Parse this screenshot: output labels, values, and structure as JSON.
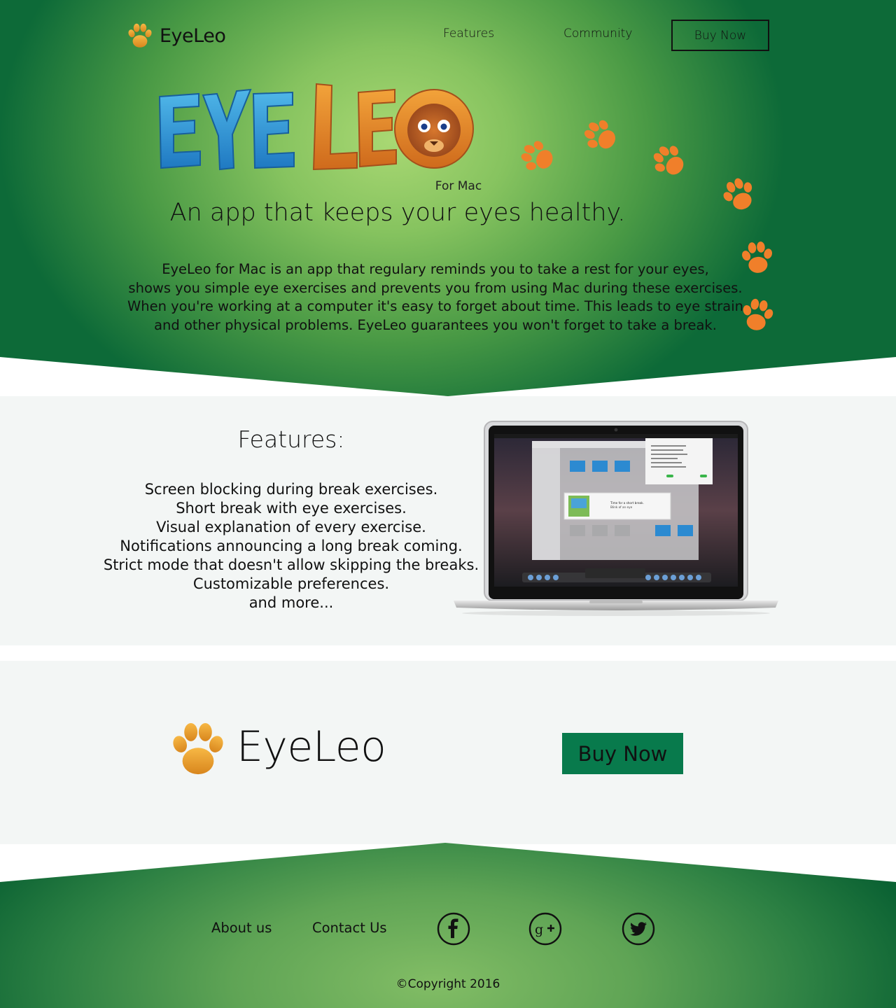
{
  "brand": {
    "name": "EyeLeo"
  },
  "nav": {
    "items": [
      {
        "label": "Features"
      },
      {
        "label": "Community"
      }
    ],
    "buy_label": "Buy Now"
  },
  "hero": {
    "logo_lettering": "EYELEO",
    "subtitle": "For Mac",
    "tagline": "An app that keeps your eyes healthy.",
    "intro_lines": [
      "EyeLeo for Mac is an app that regulary reminds you to take a rest for your eyes,",
      "shows you simple eye exercises and prevents you from using Mac during these exercises.",
      "When you're working at a computer it's easy to forget about time. This leads to eye strain",
      "and other physical problems. EyeLeo guarantees you won't forget to take a break."
    ]
  },
  "features": {
    "title": "Features:",
    "items": [
      "Screen blocking during break exercises.",
      "Short break with eye exercises.",
      "Visual explanation of every exercise.",
      "Notifications announcing a long break coming.",
      "Strict mode that doesn't allow skipping the breaks.",
      "Customizable preferences.",
      "and more..."
    ],
    "screenshot": {
      "notification_title": "Time for a short break.",
      "notification_body": "Blink of an eye"
    }
  },
  "cta": {
    "name": "EyeLeo",
    "buy_label": "Buy Now"
  },
  "footer": {
    "links": [
      {
        "label": "About us"
      },
      {
        "label": "Contact Us"
      }
    ],
    "social": [
      "facebook-icon",
      "google-plus-icon",
      "twitter-icon"
    ],
    "copyright": "©Copyright 2016"
  },
  "colors": {
    "hero_light": "#a9d873",
    "hero_dark": "#0d6a38",
    "buy_button": "#087a4c",
    "paw_orange": "#f07f2a",
    "section_bg": "#f3f6f5"
  }
}
